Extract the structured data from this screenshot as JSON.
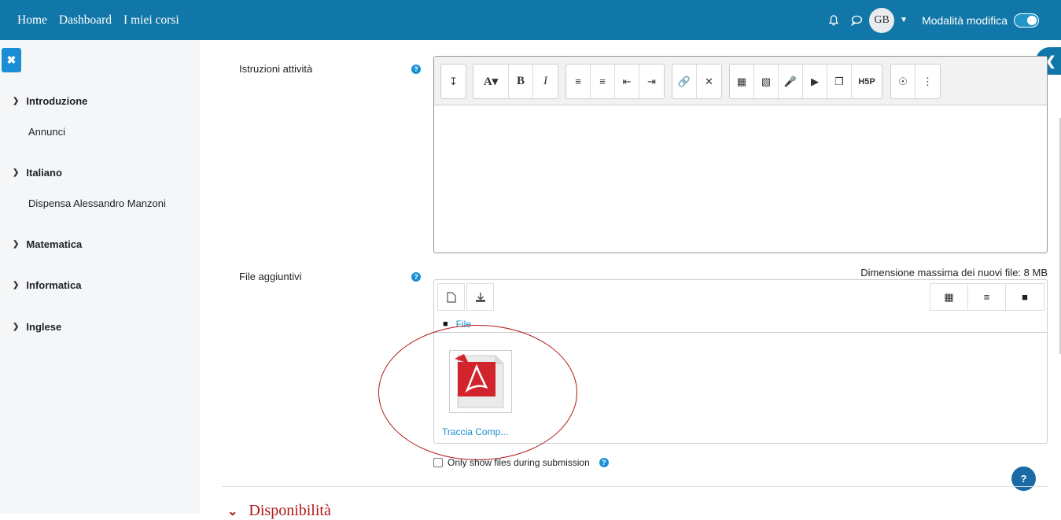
{
  "nav": {
    "links": [
      "Home",
      "Dashboard",
      "I miei corsi"
    ],
    "avatar_initials": "GB",
    "edit_mode_label": "Modalità modifica",
    "edit_mode_on": true
  },
  "drawer": {
    "sections": [
      {
        "title": "Introduzione",
        "items": [
          "Annunci"
        ]
      },
      {
        "title": "Italiano",
        "items": [
          "Dispensa Alessandro Manzoni"
        ]
      },
      {
        "title": "Matematica",
        "items": []
      },
      {
        "title": "Informatica",
        "items": []
      },
      {
        "title": "Inglese",
        "items": []
      }
    ]
  },
  "form": {
    "instructions_label": "Istruzioni attività",
    "files_label": "File aggiuntivi",
    "max_size_text": "Dimensione massima dei nuovi file: 8 MB",
    "path_label": "File",
    "file_name": "Traccia Comp...",
    "only_show_label": "Only show files during submission",
    "section_title": "Disponibilità"
  },
  "toolbar_icons": [
    "expand-icon",
    "font-color-icon",
    "bold-icon",
    "italic-icon",
    "unordered-list-icon",
    "ordered-list-icon",
    "outdent-icon",
    "indent-icon",
    "link-icon",
    "unlink-icon",
    "image-icon",
    "media-icon",
    "record-audio-icon",
    "record-video-icon",
    "manage-files-icon",
    "h5p-icon",
    "accessibility-checker-icon",
    "screenreader-helper-icon"
  ],
  "colors": {
    "navbar": "#1177a8",
    "accent": "#1a8ed4",
    "highlight_circle": "#b01818"
  }
}
